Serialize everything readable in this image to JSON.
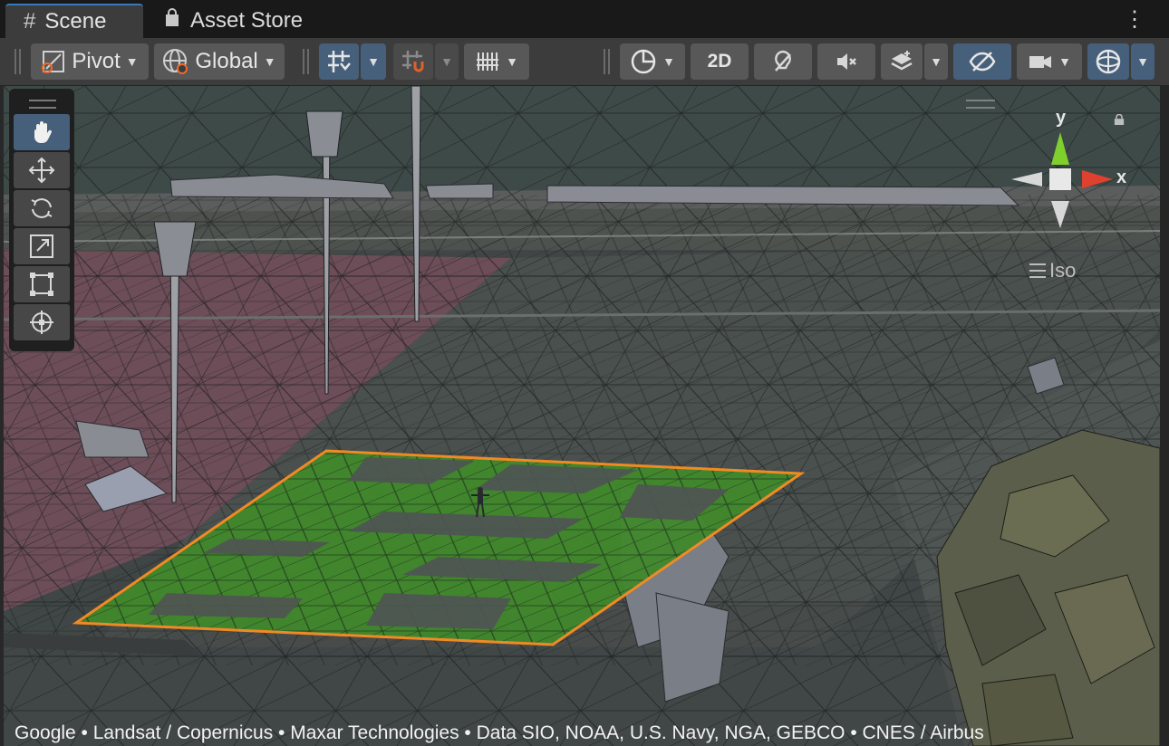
{
  "tabs": [
    {
      "label": "Scene",
      "icon": "grid-hash-icon"
    },
    {
      "label": "Asset Store",
      "icon": "shopping-bag-icon"
    }
  ],
  "toolbar": {
    "pivot_label": "Pivot",
    "global_label": "Global",
    "mode_2d_label": "2D"
  },
  "tool_palette": [
    "hand-tool",
    "move-tool",
    "rotate-tool",
    "scale-tool",
    "rect-tool",
    "transform-tool"
  ],
  "gizmo": {
    "y_label": "y",
    "x_label": "x",
    "projection_label": "Iso"
  },
  "attribution": "Google • Landsat / Copernicus • Maxar Technologies • Data SIO, NOAA, U.S. Navy, NGA, GEBCO • CNES / Airbus",
  "colors": {
    "accent": "#46607c",
    "selection_outline": "#f08a24",
    "ground_green": "#3e8e2a",
    "x_axis": "#e0412f",
    "y_axis": "#7fcf2d"
  }
}
